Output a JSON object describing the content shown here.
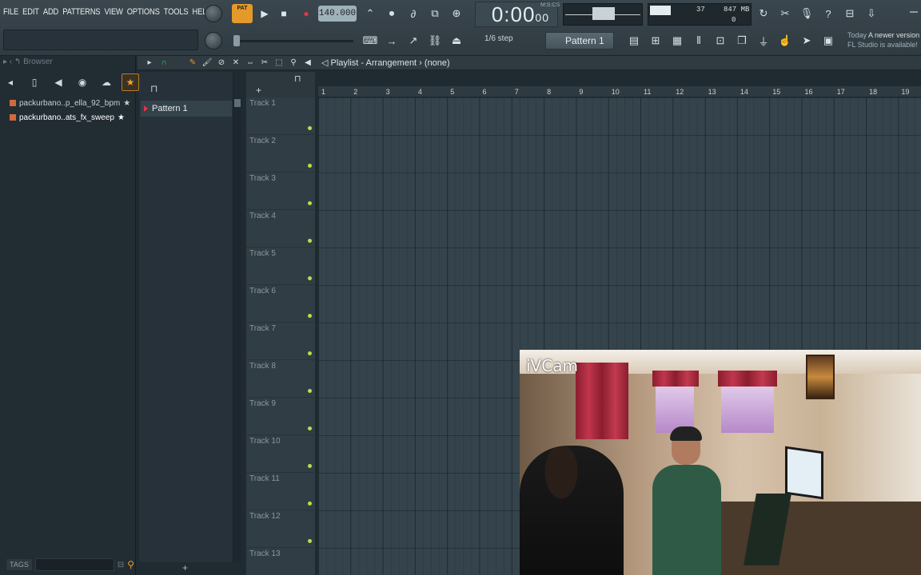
{
  "menu": [
    "FILE",
    "EDIT",
    "ADD",
    "PATTERNS",
    "VIEW",
    "OPTIONS",
    "TOOLS",
    "HELP"
  ],
  "transport": {
    "pat_song_label": "PAT",
    "tempo": "140.000",
    "time": "0:00",
    "time_small": "00",
    "time_unit": "M:S:CS",
    "cpu_value": "37",
    "memory": "847 MB",
    "memory_sub": "0"
  },
  "toolbar2": {
    "step": "1/6 step",
    "pattern": "Pattern 1"
  },
  "news": {
    "line1": "Today",
    "line1b": "A newer version",
    "line2": "FL Studio is available!"
  },
  "browser": {
    "title": "Browser",
    "items": [
      {
        "label": "packurbano..p_ella_92_bpm",
        "selected": false
      },
      {
        "label": "packurbano..ats_fx_sweep",
        "selected": true
      }
    ],
    "tags_label": "TAGS"
  },
  "playlist": {
    "title": "Playlist - Arrangement",
    "arrangement_sub": "(none)",
    "patterns": [
      "Pattern 1"
    ],
    "tracks": [
      "Track 1",
      "Track 2",
      "Track 3",
      "Track 4",
      "Track 5",
      "Track 6",
      "Track 7",
      "Track 8",
      "Track 9",
      "Track 10",
      "Track 11",
      "Track 12",
      "Track 13"
    ],
    "bars": [
      "1",
      "2",
      "3",
      "4",
      "5",
      "6",
      "7",
      "8",
      "9",
      "10",
      "11",
      "12",
      "13",
      "14",
      "15",
      "16",
      "17",
      "18",
      "19"
    ]
  },
  "webcam": {
    "label": "iVCam"
  },
  "colors": {
    "accent": "#e49a2b",
    "record": "#e2344b",
    "track_dot": "#b7e04b",
    "grid": "#35444c"
  }
}
